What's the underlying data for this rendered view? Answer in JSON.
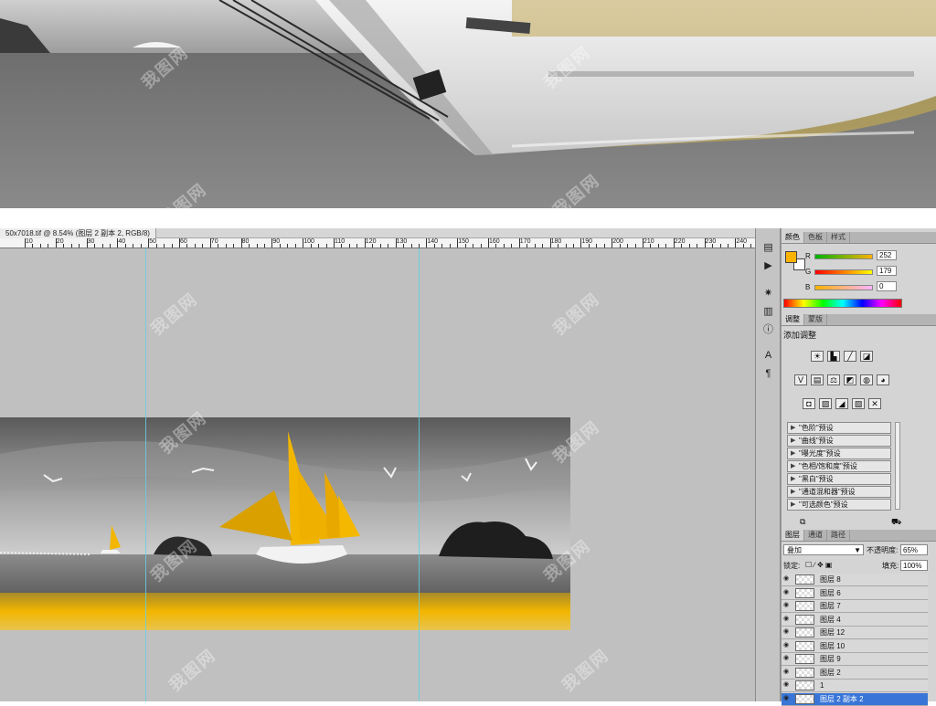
{
  "document": {
    "tab_title": "50x7018.tif @ 8.54% (图层 2 副本 2, RGB/8)",
    "ruler_labels": [
      "10",
      "20",
      "30",
      "40",
      "50",
      "60",
      "70",
      "80",
      "90",
      "100",
      "110",
      "120",
      "130",
      "140",
      "150",
      "160",
      "170",
      "180",
      "190",
      "200",
      "210",
      "220",
      "230",
      "240"
    ]
  },
  "color_panel": {
    "tabs": [
      "颜色",
      "色板",
      "样式"
    ],
    "foreground_color": "#fcb300",
    "background_color": "#ffffff",
    "channels": [
      {
        "label": "R",
        "value": "252"
      },
      {
        "label": "G",
        "value": "179"
      },
      {
        "label": "B",
        "value": "0"
      }
    ]
  },
  "adjust_panel": {
    "tabs": [
      "调整",
      "蒙版"
    ],
    "title": "添加调整",
    "presets": [
      "\"色阶\"预设",
      "\"曲线\"预设",
      "\"曝光度\"预设",
      "\"色相/饱和度\"预设",
      "\"黑白\"预设",
      "\"通道混和器\"预设",
      "\"可选颜色\"预设"
    ]
  },
  "layers_panel": {
    "tabs": [
      "图层",
      "通道",
      "路径"
    ],
    "blend_mode": "叠加",
    "opacity_label": "不透明度:",
    "opacity_value": "65%",
    "lock_label": "锁定:",
    "fill_label": "填充:",
    "fill_value": "100%",
    "layers": [
      "图层 8",
      "图层 6",
      "图层 7",
      "图层 4",
      "图层 12",
      "图层 10",
      "图层 9",
      "图层 2",
      "1",
      "图层 2 副本 2"
    ]
  },
  "watermark": "我图网",
  "icons": [
    "history-icon",
    "actions-icon",
    "navigator-icon",
    "histogram-icon",
    "info-icon",
    "character-icon",
    "paragraph-icon"
  ]
}
